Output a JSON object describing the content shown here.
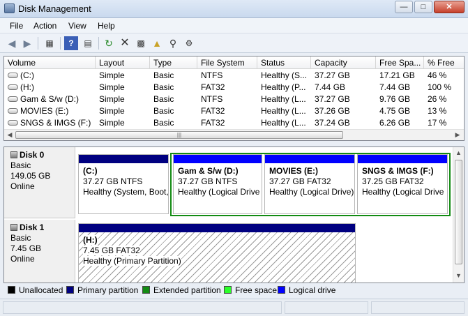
{
  "window": {
    "title": "Disk Management"
  },
  "menu": [
    "File",
    "Action",
    "View",
    "Help"
  ],
  "columns": [
    "Volume",
    "Layout",
    "Type",
    "File System",
    "Status",
    "Capacity",
    "Free Spa...",
    "% Free"
  ],
  "volumes": [
    [
      "(C:)",
      "Simple",
      "Basic",
      "NTFS",
      "Healthy (S...",
      "37.27 GB",
      "17.21 GB",
      "46 %"
    ],
    [
      "(H:)",
      "Simple",
      "Basic",
      "FAT32",
      "Healthy (P...",
      "7.44 GB",
      "7.44 GB",
      "100 %"
    ],
    [
      "Gam & S/w (D:)",
      "Simple",
      "Basic",
      "NTFS",
      "Healthy (L...",
      "37.27 GB",
      "9.76 GB",
      "26 %"
    ],
    [
      "MOVIES (E:)",
      "Simple",
      "Basic",
      "FAT32",
      "Healthy (L...",
      "37.26 GB",
      "4.75 GB",
      "13 %"
    ],
    [
      "SNGS & IMGS (F:)",
      "Simple",
      "Basic",
      "FAT32",
      "Healthy (L...",
      "37.24 GB",
      "6.26 GB",
      "17 %"
    ]
  ],
  "disks": [
    {
      "name": "Disk 0",
      "type": "Basic",
      "size": "149.05 GB",
      "status": "Online",
      "partitions": [
        {
          "label": "(C:)",
          "fs": "37.27 GB NTFS",
          "status": "Healthy (System, Boot,",
          "kind": "primary"
        },
        {
          "label": "Gam & S/w  (D:)",
          "fs": "37.27 GB NTFS",
          "status": "Healthy (Logical Drive",
          "kind": "logical"
        },
        {
          "label": "MOVIES  (E:)",
          "fs": "37.27 GB FAT32",
          "status": "Healthy (Logical Drive)",
          "kind": "logical"
        },
        {
          "label": "SNGS & IMGS  (F:)",
          "fs": "37.25 GB FAT32",
          "status": "Healthy (Logical Drive",
          "kind": "logical"
        }
      ]
    },
    {
      "name": "Disk 1",
      "type": "Basic",
      "size": "7.45 GB",
      "status": "Online",
      "partitions": [
        {
          "label": "(H:)",
          "fs": "7.45 GB FAT32",
          "status": "Healthy (Primary Partition)",
          "kind": "primary"
        }
      ]
    }
  ],
  "legend": [
    {
      "label": "Unallocated",
      "color": "#000000"
    },
    {
      "label": "Primary partition",
      "color": "#000080"
    },
    {
      "label": "Extended partition",
      "color": "#138b13"
    },
    {
      "label": "Free space",
      "color": "#2aff2a"
    },
    {
      "label": "Logical drive",
      "color": "#0000ff"
    }
  ],
  "toolbar_icons": [
    "back-arrow-icon",
    "forward-arrow-icon",
    "show-hide-console-tree-icon",
    "help-icon",
    "help-topics-icon",
    "refresh-icon",
    "delete-icon",
    "properties-icon",
    "open-folder-icon",
    "search-icon",
    "settings-icon"
  ]
}
